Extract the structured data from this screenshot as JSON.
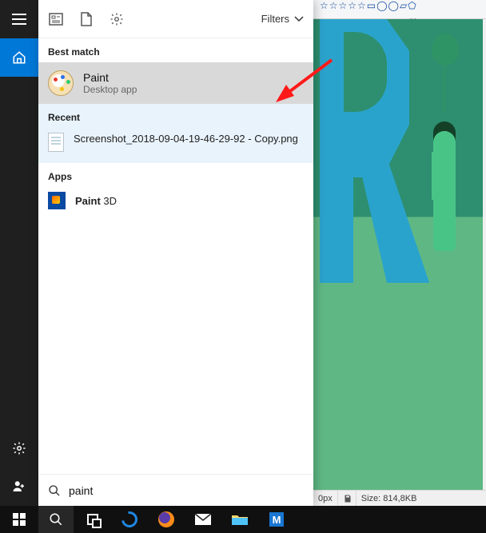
{
  "ribbon": {
    "shapes_label": "Shapes",
    "shapes_glyphs": "☆☆☆☆☆▭◯◯▱⬠"
  },
  "panel": {
    "top": {
      "filters_label": "Filters"
    },
    "best_match": {
      "header": "Best match",
      "title": "Paint",
      "subtitle": "Desktop app"
    },
    "recent": {
      "header": "Recent",
      "item": "Screenshot_2018-09-04-19-46-29-92 - Copy.png"
    },
    "apps": {
      "header": "Apps",
      "item_bold": "Paint",
      "item_rest": " 3D"
    },
    "search": {
      "value": "paint"
    }
  },
  "statusbar": {
    "px_label": "0px",
    "size_label": "Size: 814,8KB"
  }
}
